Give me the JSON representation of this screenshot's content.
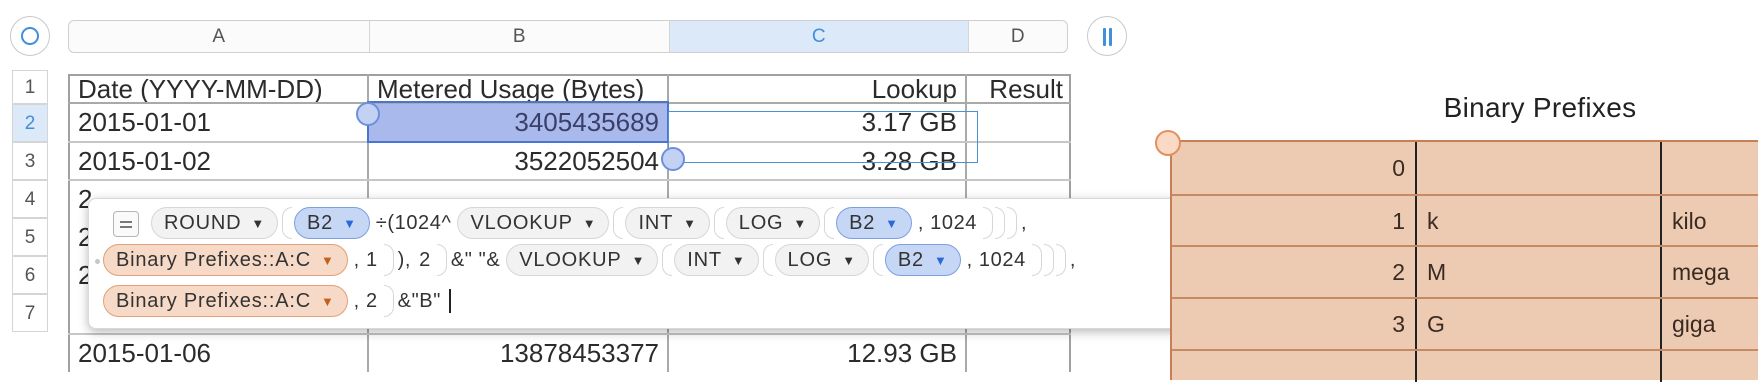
{
  "columns": [
    "A",
    "B",
    "C",
    "D"
  ],
  "selected_column": "C",
  "rows": [
    "1",
    "2",
    "3",
    "4",
    "5",
    "6",
    "7"
  ],
  "selected_row": "2",
  "table": {
    "headers": [
      "Date (YYYY-MM-DD)",
      "Metered Usage (Bytes)",
      "Lookup",
      "Result"
    ],
    "data": [
      [
        "2015-01-01",
        "3405435689",
        "3.17 GB",
        ""
      ],
      [
        "2015-01-02",
        "3522052504",
        "3.28 GB",
        ""
      ],
      [
        "2",
        "",
        "",
        ""
      ],
      [
        "2",
        "",
        "",
        ""
      ],
      [
        "2",
        "",
        "",
        ""
      ],
      [
        "2015-01-06",
        "13878453377",
        "12.93 GB",
        ""
      ]
    ]
  },
  "formula": {
    "line1": {
      "round": "ROUND",
      "b2_a": "B2",
      "op1": "÷(1024^",
      "vlookup": "VLOOKUP",
      "int": "INT",
      "log": "LOG",
      "b2_b": "B2",
      "num1": ", 1024",
      "comma": ","
    },
    "line2": {
      "range": "Binary Prefixes::A:C",
      "arg1": ", 1",
      "close": "),",
      "two": "2",
      "concat": "&\" \"&",
      "vlookup": "VLOOKUP",
      "int": "INT",
      "log": "LOG",
      "b2": "B2",
      "num": ", 1024",
      "comma": ","
    },
    "line3": {
      "range": "Binary Prefixes::A:C",
      "arg": ", 2",
      "tail": "&\"B\""
    }
  },
  "binary_prefixes": {
    "title": "Binary Prefixes",
    "rows": [
      [
        "0",
        "",
        ""
      ],
      [
        "1",
        "k",
        "kilo"
      ],
      [
        "2",
        "M",
        "mega"
      ],
      [
        "3",
        "G",
        "giga"
      ]
    ]
  },
  "colors": {
    "selection_accent": "#3f8fdc",
    "selected_cell_fill": "#aab9ec",
    "reference_token": "#c6d6f5",
    "range_token": "#f6d9c6",
    "cancel": "#ec3a3a",
    "accept": "#3dbf3d",
    "prefix_table_fill": "#edcbb3"
  },
  "icons": {
    "corner": "select-all-icon",
    "freeze": "freeze-columns-icon",
    "cancel": "close-icon",
    "accept": "checkmark-icon"
  }
}
